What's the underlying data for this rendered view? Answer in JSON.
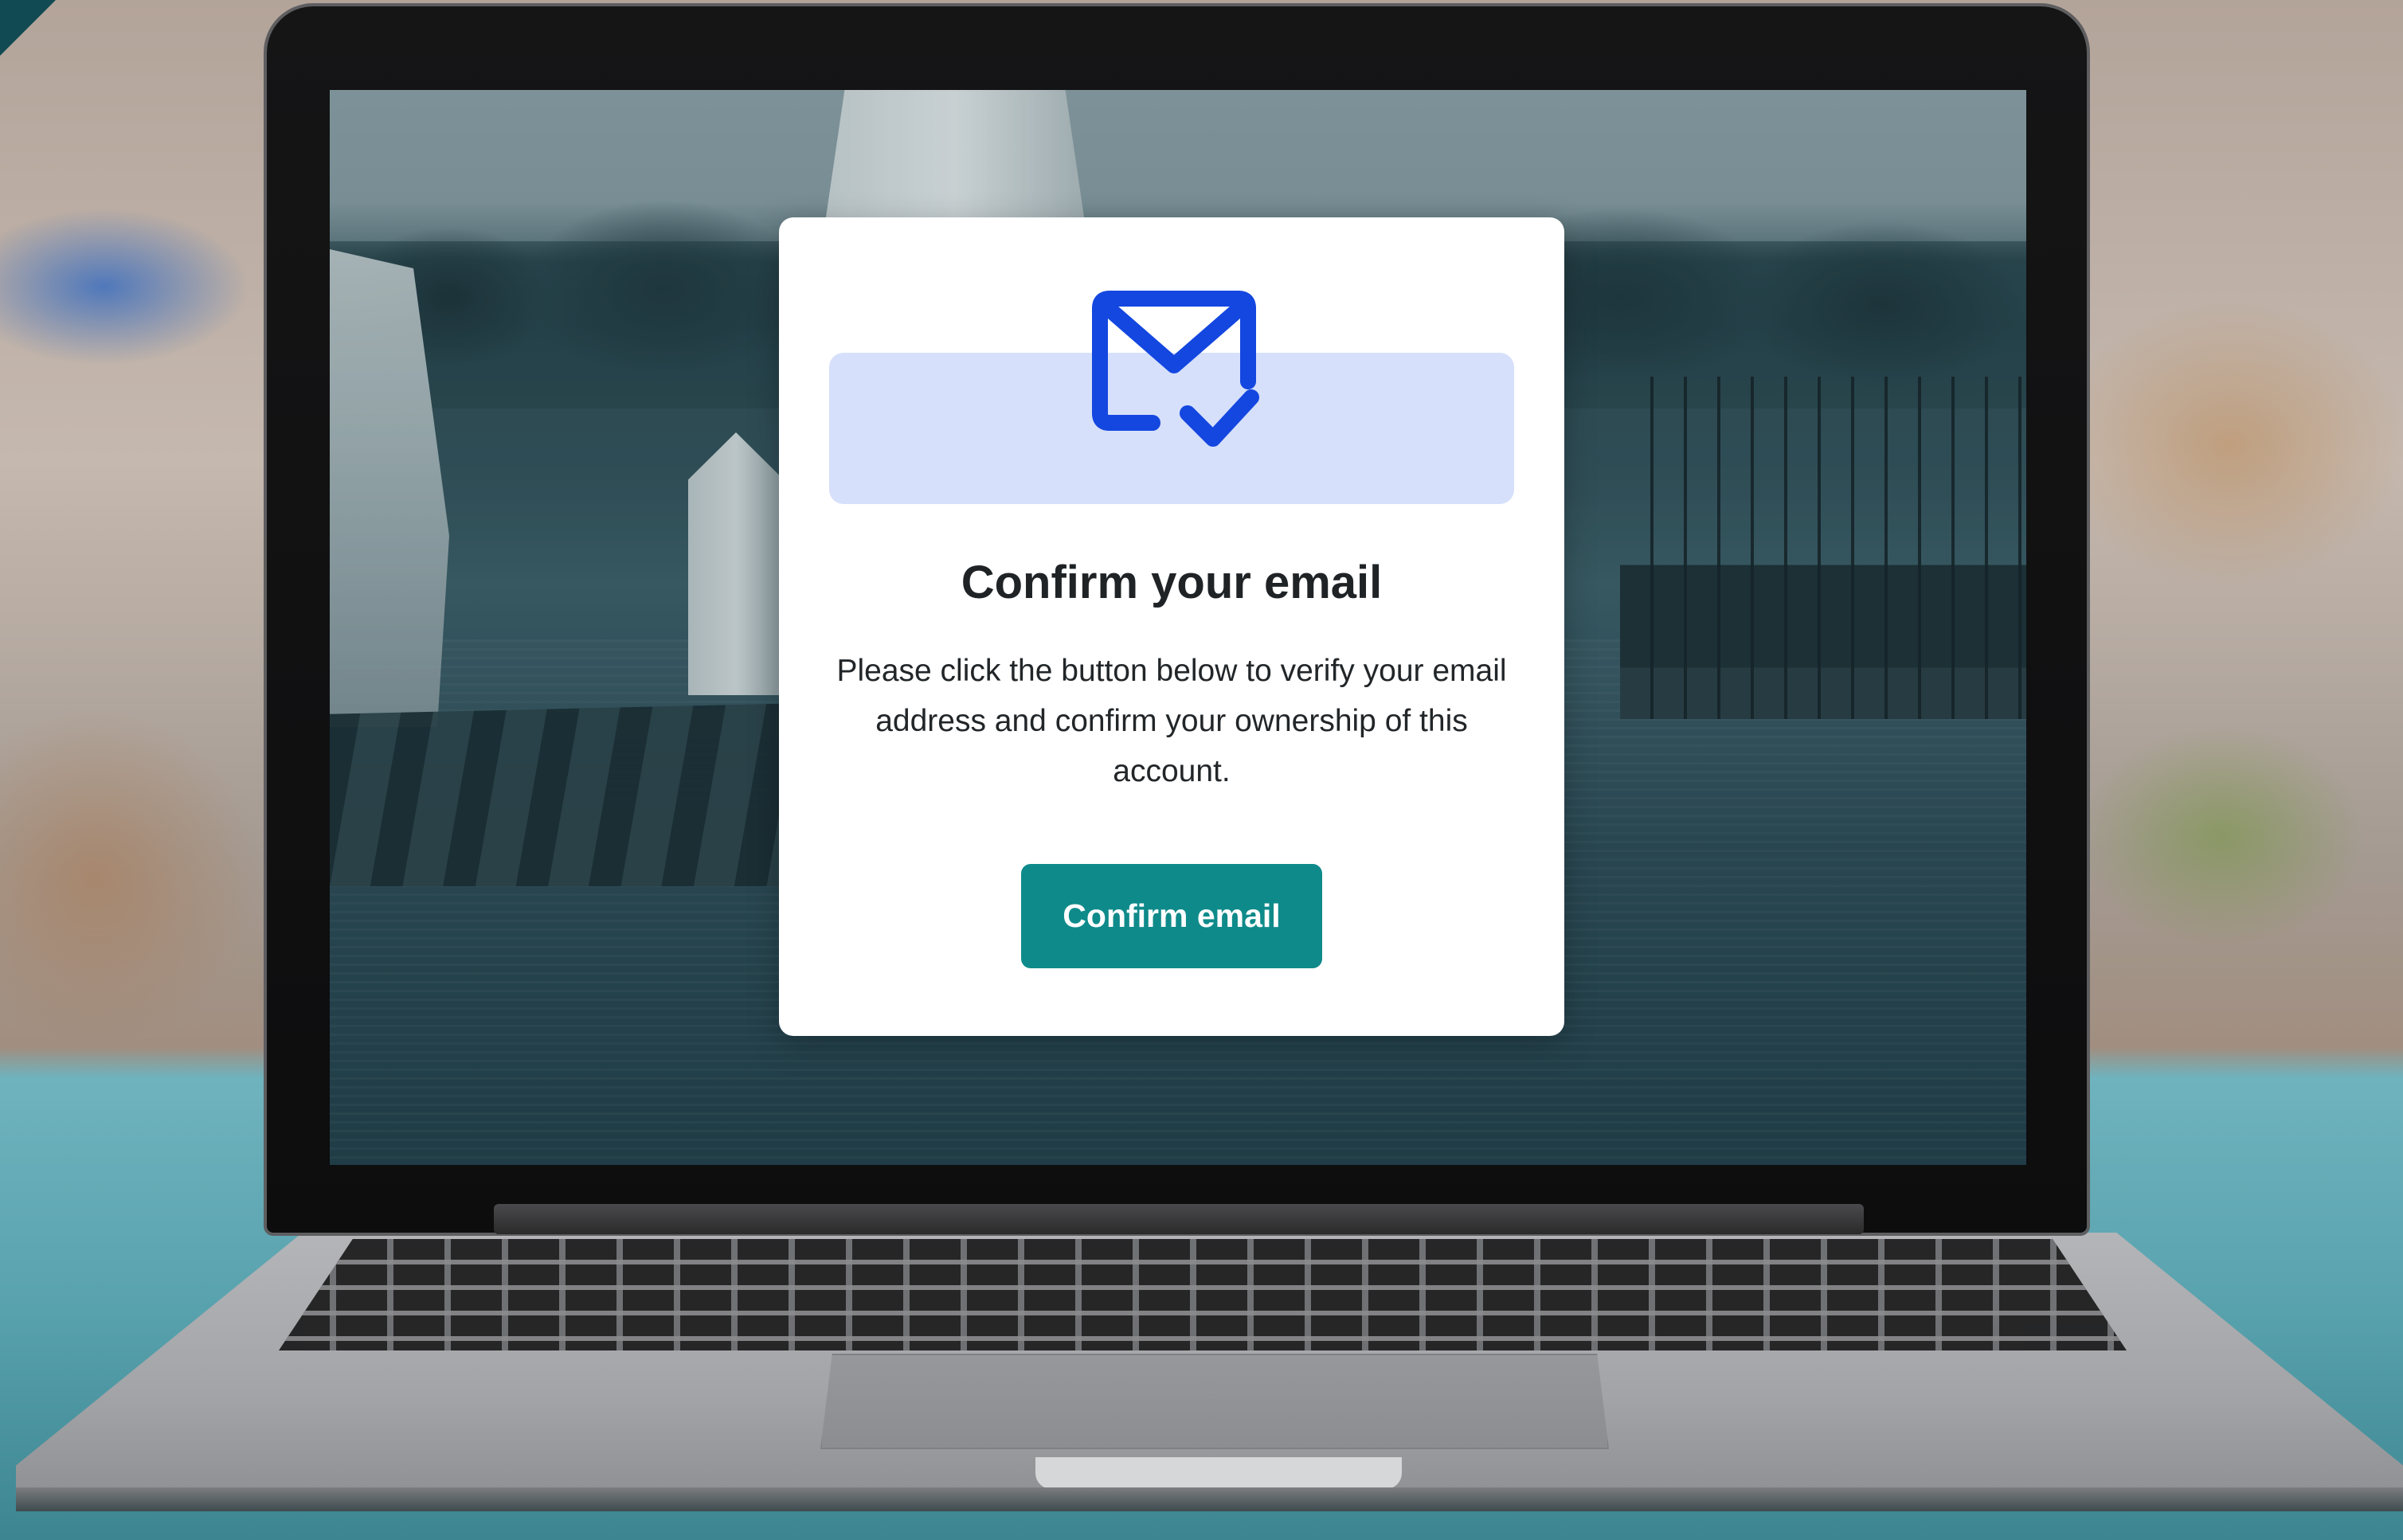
{
  "dialog": {
    "icon": "mail-check-icon",
    "title": "Confirm your email",
    "message": "Please click the button below to verify your email address and confirm your ownership of this account.",
    "confirm_button_label": "Confirm email"
  },
  "colors": {
    "accent": "#0f8a8a",
    "icon": "#1447e0",
    "illustration_band": "#d6e0fb",
    "card_background": "#ffffff",
    "text": "#1f2326"
  }
}
